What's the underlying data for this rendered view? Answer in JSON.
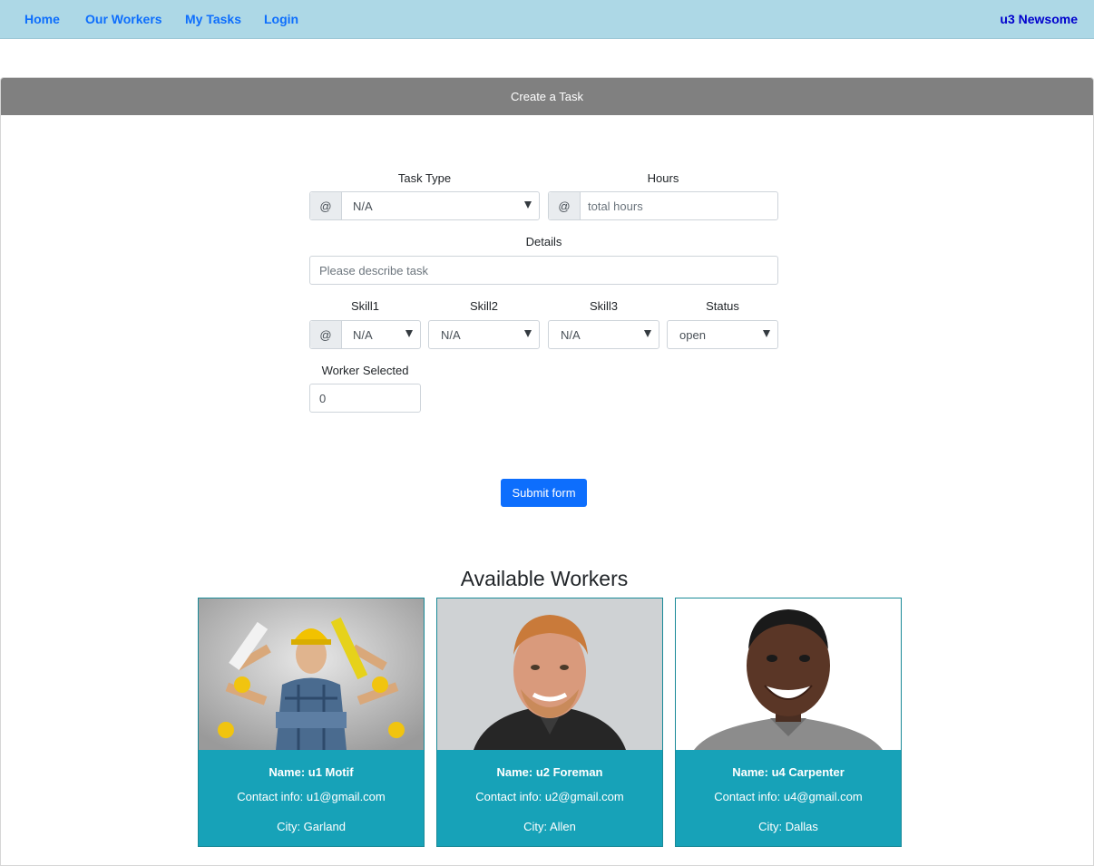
{
  "nav": {
    "links": [
      "Home",
      "Our Workers",
      "My Tasks",
      "Login"
    ],
    "user": "u3 Newsome"
  },
  "form": {
    "title": "Create a Task",
    "task_type": {
      "label": "Task Type",
      "addon": "@",
      "value": "N/A"
    },
    "hours": {
      "label": "Hours",
      "addon": "@",
      "placeholder": "total hours"
    },
    "details": {
      "label": "Details",
      "placeholder": "Please describe task"
    },
    "skill1": {
      "label": "Skill1",
      "addon": "@",
      "value": "N/A"
    },
    "skill2": {
      "label": "Skill2",
      "value": "N/A"
    },
    "skill3": {
      "label": "Skill3",
      "value": "N/A"
    },
    "status": {
      "label": "Status",
      "value": "open"
    },
    "worker_selected": {
      "label": "Worker Selected",
      "value": "0"
    },
    "submit_label": "Submit form"
  },
  "workers": {
    "title": "Available Workers",
    "cards": [
      {
        "name": "Name: u1 Motif",
        "contact": "Contact info: u1@gmail.com",
        "city": "City: Garland"
      },
      {
        "name": "Name: u2 Foreman",
        "contact": "Contact info: u2@gmail.com",
        "city": "City: Allen"
      },
      {
        "name": "Name: u4 Carpenter",
        "contact": "Contact info: u4@gmail.com",
        "city": "City: Dallas"
      }
    ]
  },
  "colors": {
    "navbar": "#add8e6",
    "header": "#808080",
    "primary": "#0d6efd",
    "worker_card": "#17a2b8"
  }
}
